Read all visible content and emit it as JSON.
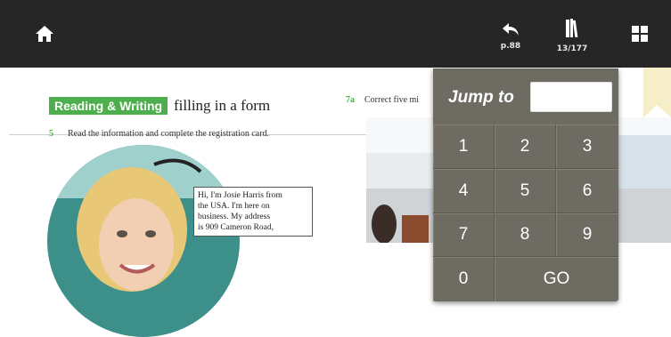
{
  "toolbar": {
    "back_label": "p.88",
    "page_label": "13/177"
  },
  "page": {
    "section_badge": "Reading & Writing",
    "section_title": "filling in a form",
    "ex5_number": "5",
    "ex5_text": "Read the information and complete the registration card.",
    "ex7_number": "7a",
    "ex7_text": "Correct five mi",
    "speech_lines": [
      "Hi, I'm Josie Harris from",
      "the USA. I'm here on",
      "business. My address",
      "is 909 Cameron Road,"
    ]
  },
  "jump": {
    "title": "Jump to",
    "input_value": "",
    "keys": [
      "1",
      "2",
      "3",
      "4",
      "5",
      "6",
      "7",
      "8",
      "9",
      "0"
    ],
    "go_label": "GO"
  },
  "colors": {
    "toolbar_bg": "#262626",
    "numpad_bg": "#6e6c62",
    "section_green": "#4cae4c"
  },
  "icons": [
    "home-icon",
    "back-arrow-icon",
    "book-icon",
    "grid-icon"
  ]
}
